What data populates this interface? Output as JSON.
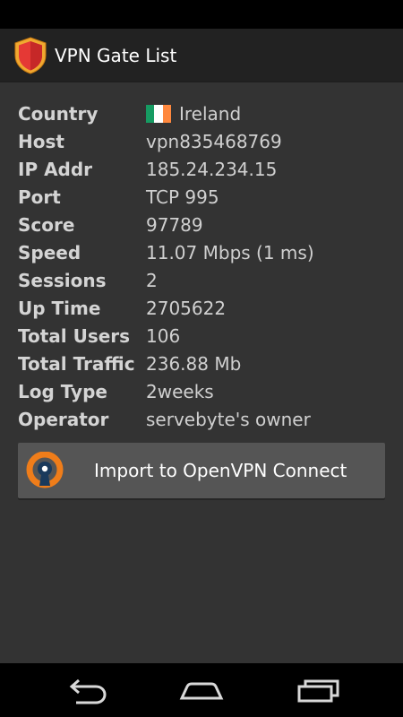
{
  "app": {
    "title": "VPN Gate List"
  },
  "details": [
    {
      "label": "Country",
      "value": "Ireland",
      "flag_colors": [
        "#169b62",
        "#ffffff",
        "#ff883e"
      ]
    },
    {
      "label": "Host",
      "value": "vpn835468769"
    },
    {
      "label": "IP Addr",
      "value": "185.24.234.15"
    },
    {
      "label": "Port",
      "value": "TCP 995"
    },
    {
      "label": "Score",
      "value": "97789"
    },
    {
      "label": "Speed",
      "value": "11.07 Mbps (1 ms)"
    },
    {
      "label": "Sessions",
      "value": "2"
    },
    {
      "label": "Up Time",
      "value": "2705622"
    },
    {
      "label": "Total Users",
      "value": "106"
    },
    {
      "label": "Total Traffic",
      "value": "236.88 Mb"
    },
    {
      "label": "Log Type",
      "value": "2weeks"
    },
    {
      "label": "Operator",
      "value": "servebyte's owner"
    }
  ],
  "import_button": {
    "label": "Import to OpenVPN Connect",
    "icon": "openvpn-icon"
  },
  "nav": {
    "back_icon": "back-icon",
    "home_icon": "home-icon",
    "recents_icon": "recents-icon"
  },
  "colors": {
    "action_bar": "#222222",
    "background": "#333333",
    "button": "#555555",
    "shield": "#e53935",
    "openvpn_orange": "#ef7d1a",
    "openvpn_navy": "#1a3a5c"
  }
}
